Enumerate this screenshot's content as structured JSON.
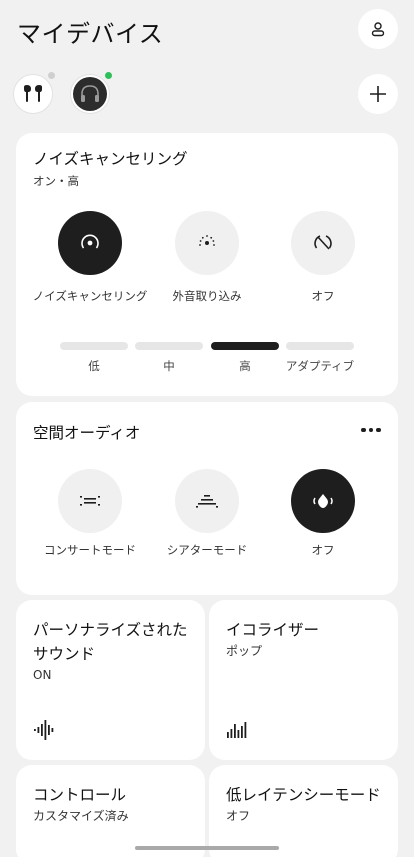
{
  "header": {
    "title": "マイデバイス",
    "account_icon": "person-icon"
  },
  "devices": [
    {
      "icon": "earbuds-icon",
      "status": "disconnected",
      "status_color": "#cfcfcf"
    },
    {
      "icon": "headphones-icon",
      "status": "connected",
      "status_color": "#2fbf5a"
    }
  ],
  "add_icon": "plus-icon",
  "anc": {
    "title": "ノイズキャンセリング",
    "subtitle": "オン・高",
    "modes": [
      {
        "label": "ノイズキャンセリング",
        "icon": "noise-cancel-icon",
        "active": true
      },
      {
        "label": "外音取り込み",
        "icon": "transparency-icon",
        "active": false
      },
      {
        "label": "オフ",
        "icon": "off-icon",
        "active": false
      }
    ],
    "levels": [
      {
        "label": "低",
        "active": false
      },
      {
        "label": "中",
        "active": false
      },
      {
        "label": "高",
        "active": true
      },
      {
        "label": "アダプティブ",
        "active": false
      }
    ]
  },
  "spatial": {
    "title": "空間オーディオ",
    "more_icon": "more-icon",
    "modes": [
      {
        "label": "コンサートモード",
        "icon": "concert-icon",
        "active": false
      },
      {
        "label": "シアターモード",
        "icon": "theater-icon",
        "active": false
      },
      {
        "label": "オフ",
        "icon": "spatial-off-icon",
        "active": true
      }
    ]
  },
  "tiles": {
    "personal": {
      "title": "パーソナライズされたサウンド",
      "value": "ON",
      "icon": "personal-sound-icon"
    },
    "eq": {
      "title": "イコライザー",
      "value": "ポップ",
      "icon": "equalizer-icon"
    },
    "control": {
      "title": "コントロール",
      "value": "カスタマイズ済み"
    },
    "latency": {
      "title": "低レイテンシーモード",
      "value": "オフ"
    }
  },
  "colors": {
    "background": "#f1f1f1",
    "card": "#ffffff",
    "active": "#1e1e1e",
    "inactive": "#f0f0f0"
  }
}
